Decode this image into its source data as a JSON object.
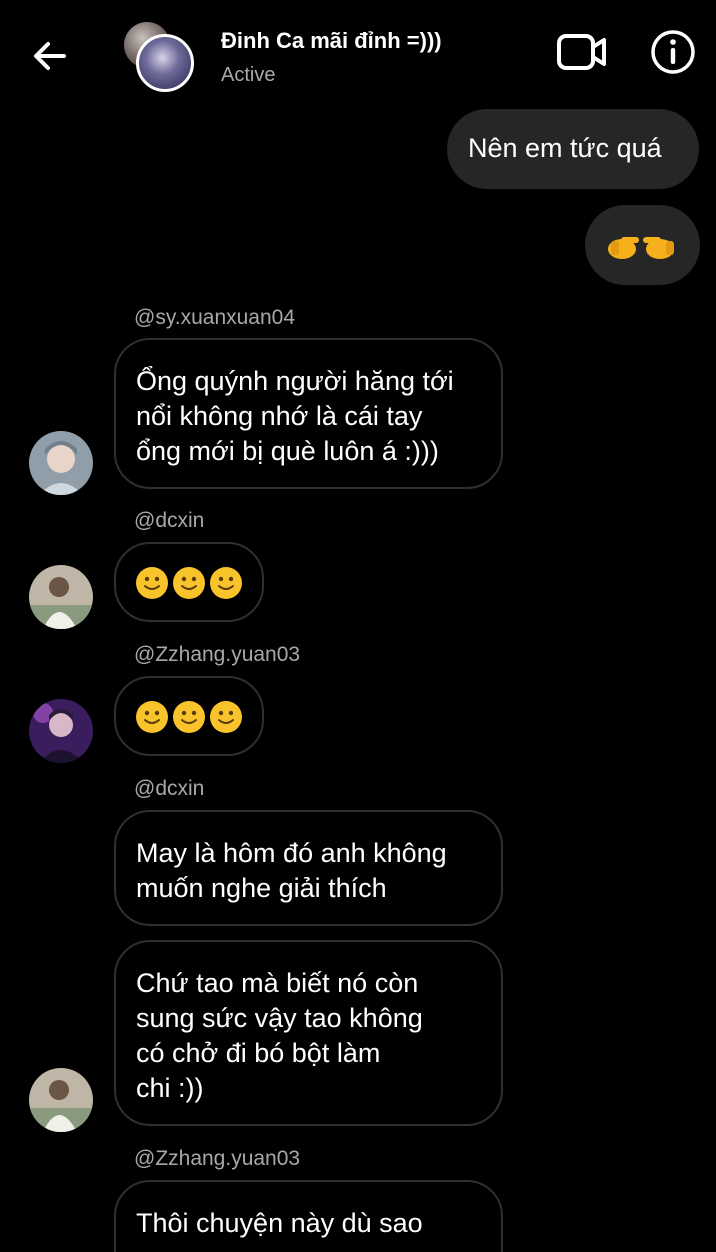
{
  "header": {
    "title": "Đinh Ca mãi đỉnh =)))",
    "status": "Active"
  },
  "messages": {
    "out1": {
      "text": "Nên em tức quá"
    },
    "out2": {
      "emoji": "pointing-hands"
    },
    "m1": {
      "username": "@sy.xuanxuan04",
      "lines": [
        "Ổng quýnh người hăng tới",
        "nổi không nhớ là cái tay",
        "ổng mới bị què luôn á :)))"
      ]
    },
    "m2": {
      "username": "@dcxin",
      "emoji": "three slightly smiling faces"
    },
    "m3": {
      "username": "@Zzhang.yuan03",
      "emoji": "three slightly smiling faces"
    },
    "m4": {
      "username": "@dcxin",
      "lines": [
        "May là hôm đó anh không",
        "muốn nghe giải thích"
      ]
    },
    "m5": {
      "lines": [
        "Chứ tao mà biết nó còn",
        "sung sức vậy tao không",
        "có chở đi bó bột làm",
        "chi :))"
      ]
    },
    "m6": {
      "username": "@Zzhang.yuan03",
      "lines": [
        "Thôi chuyện này dù sao"
      ]
    }
  },
  "colors": {
    "background": "#000000",
    "outgoing_bubble": "#262626",
    "incoming_border": "#2f2f2f",
    "secondary_text": "#a8a8a8"
  }
}
